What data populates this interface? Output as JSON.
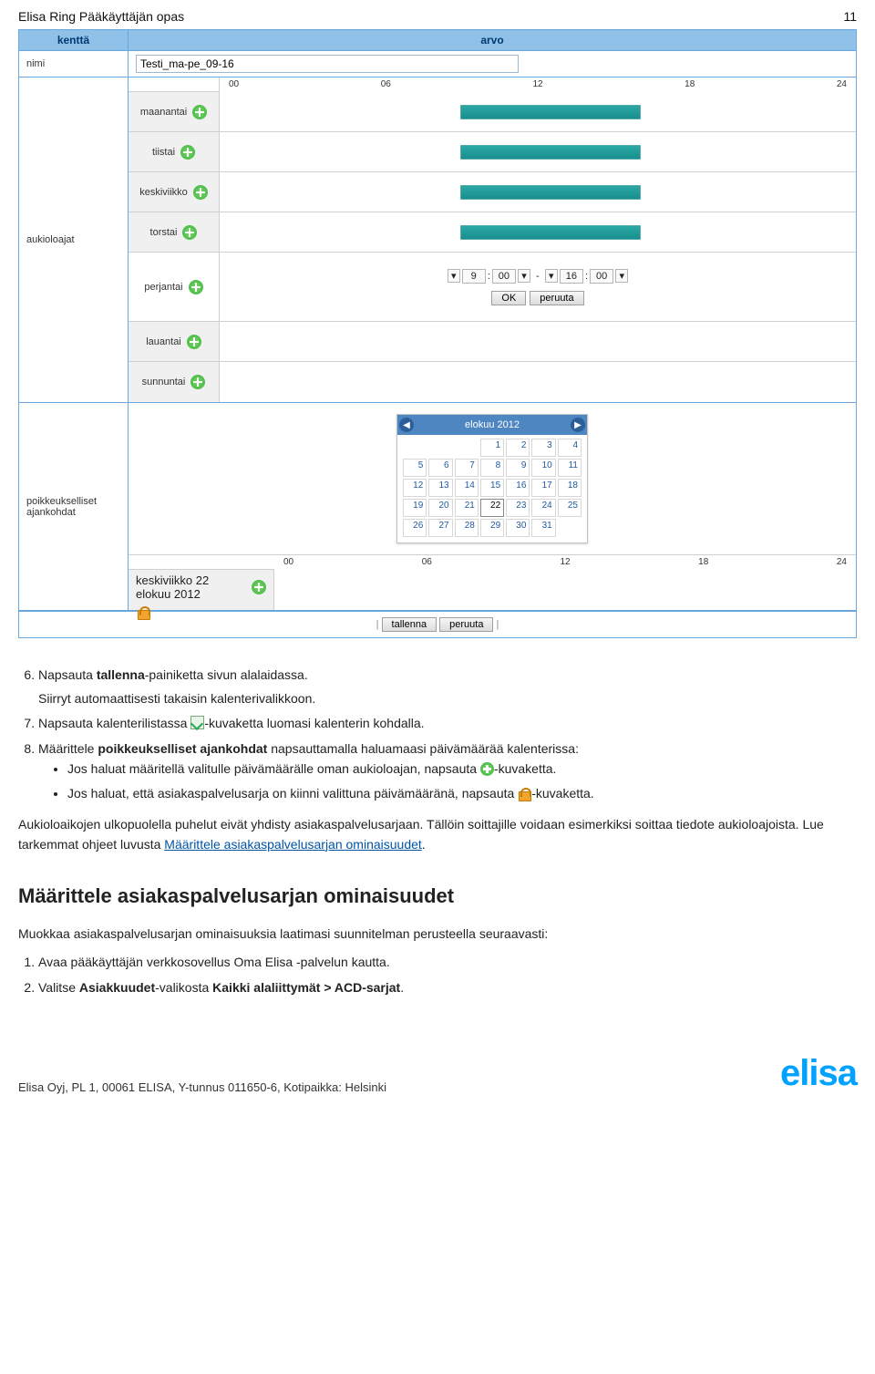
{
  "header": {
    "title": "Elisa Ring Pääkäyttäjän opas",
    "page": "11"
  },
  "ui": {
    "columns": {
      "kentta": "kenttä",
      "arvo": "arvo"
    },
    "rows": {
      "nimi": {
        "label": "nimi",
        "value": "Testi_ma-pe_09-16"
      },
      "aukioloajat": {
        "label": "aukioloajat",
        "ticks": [
          "00",
          "06",
          "12",
          "18",
          "24"
        ],
        "days": {
          "mon": {
            "label": "maanantai",
            "bar": true
          },
          "tue": {
            "label": "tiistai",
            "bar": true
          },
          "wed": {
            "label": "keskiviikko",
            "bar": true
          },
          "thu": {
            "label": "torstai",
            "bar": true
          },
          "fri": {
            "label": "perjantai",
            "time": {
              "h1": "9",
              "m1": "00",
              "sep": "-",
              "h2": "16",
              "m2": "00"
            },
            "ok": "OK",
            "cancel": "peruuta"
          },
          "sat": {
            "label": "lauantai",
            "bar": false
          },
          "sun": {
            "label": "sunnuntai",
            "bar": false
          }
        }
      },
      "poikkeukset": {
        "label": "poikkeukselliset ajankohdat",
        "calendar": {
          "title": "elokuu 2012",
          "days": [
            1,
            2,
            3,
            4,
            5,
            6,
            7,
            8,
            9,
            10,
            11,
            12,
            13,
            14,
            15,
            16,
            17,
            18,
            19,
            20,
            21,
            22,
            23,
            24,
            25,
            26,
            27,
            28,
            29,
            30,
            31
          ],
          "today": 22,
          "lead_blanks": 3
        },
        "exc_row_label": "keskiviikko 22 elokuu 2012",
        "ticks": [
          "00",
          "06",
          "12",
          "18",
          "24"
        ]
      },
      "actions": {
        "save": "tallenna",
        "cancel": "peruuta",
        "sep": "|"
      }
    }
  },
  "doc": {
    "li6_a": "Napsauta ",
    "li6_b": "tallenna",
    "li6_c": "-painiketta sivun alalaidassa.",
    "li6_sub": "Siirryt automaattisesti takaisin kalenterivalikkoon.",
    "li7_a": "Napsauta kalenterilistassa ",
    "li7_b": "-kuvaketta luomasi kalenterin kohdalla.",
    "li8_a": "Määrittele ",
    "li8_b": "poikkeukselliset ajankohdat",
    "li8_c": " napsauttamalla haluamaasi päivämäärää kalenterissa:",
    "b1_a": "Jos haluat määritellä valitulle päivämäärälle oman aukioloajan, napsauta ",
    "b1_b": "-kuvaketta.",
    "b2_a": "Jos haluat, että asiakaspalvelusarja on kiinni valittuna päivämääränä, napsauta ",
    "b2_b": "-kuvaketta.",
    "para_a": "Aukioloaikojen ulkopuolella puhelut eivät yhdisty asiakaspalvelusarjaan. Tällöin soittajille voidaan esimerkiksi soittaa tiedote aukioloajoista. Lue tarkemmat ohjeet luvusta ",
    "para_link": "Määrittele asiakaspalvelusarjan ominaisuudet",
    "para_dot": ".",
    "h2": "Määrittele asiakaspalvelusarjan ominaisuudet",
    "intro": "Muokkaa asiakaspalvelusarjan ominaisuuksia laatimasi suunnitelman perusteella seuraavasti:",
    "ol1": "Avaa pääkäyttäjän verkkosovellus Oma Elisa -palvelun kautta.",
    "ol2_a": "Valitse ",
    "ol2_b": "Asiakkuudet",
    "ol2_c": "-valikosta ",
    "ol2_d": "Kaikki alaliittymät > ACD-sarjat",
    "ol2_e": "."
  },
  "footer": {
    "text": "Elisa Oyj, PL 1, 00061 ELISA, Y-tunnus 011650-6, Kotipaikka: Helsinki",
    "logo": "elisa"
  }
}
